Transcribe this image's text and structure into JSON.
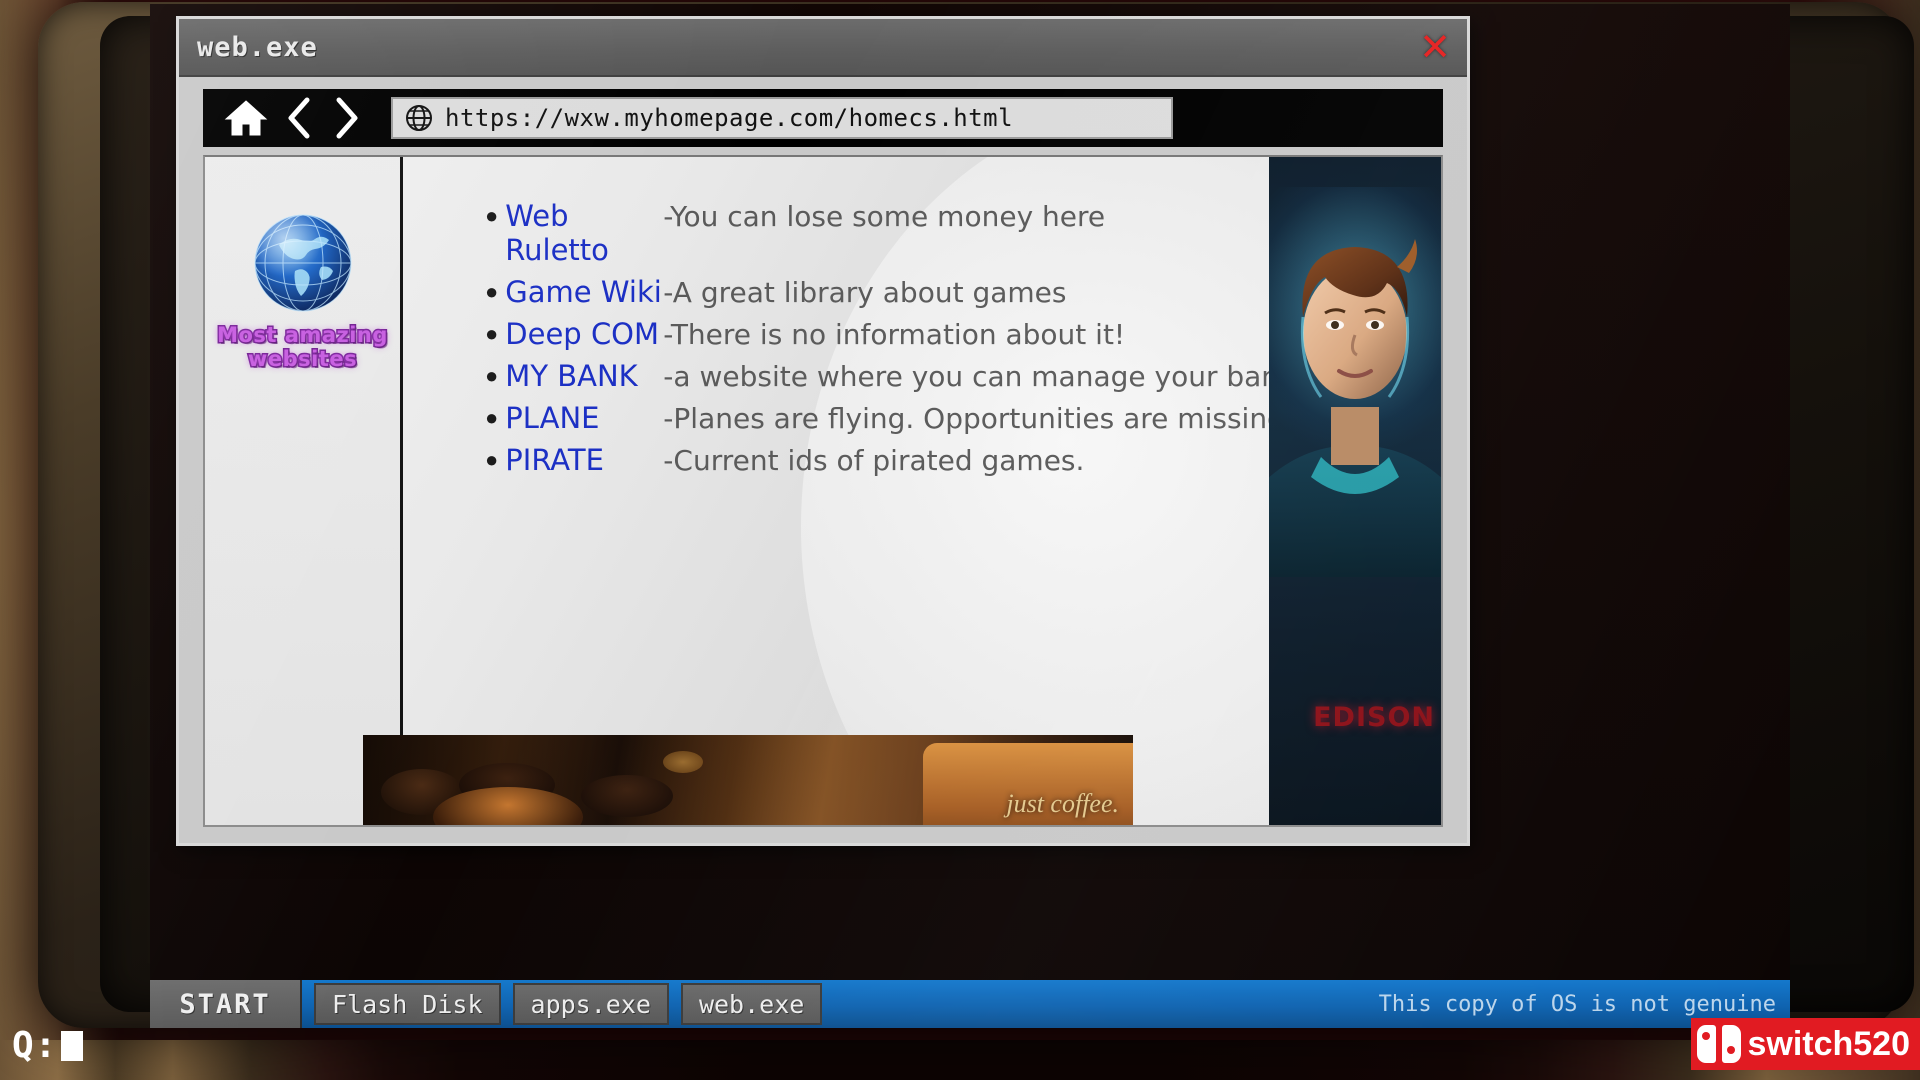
{
  "window": {
    "title": "web.exe",
    "close_label": "✕"
  },
  "browser": {
    "home_icon": "home-icon",
    "back_icon": "back-chevron-icon",
    "forward_icon": "forward-chevron-icon",
    "globe_icon": "globe-icon",
    "url": "https://wxw.myhomepage.com/homecs.html"
  },
  "sidebar": {
    "globe_icon": "world-globe-icon",
    "heading": "Most amazing websites"
  },
  "links": [
    {
      "name": "Web Ruletto",
      "desc": "-You can lose some money here"
    },
    {
      "name": "Game Wiki",
      "desc": "-A great library about games"
    },
    {
      "name": "Deep COM",
      "desc": "-There is no information about it!"
    },
    {
      "name": "MY BANK",
      "desc": "-a website where you can manage your bank accounts"
    },
    {
      "name": "PLANE",
      "desc": "-Planes are flying. Opportunities are missing.."
    },
    {
      "name": "PIRATE",
      "desc": "-Current ids of pirated games."
    }
  ],
  "banner": {
    "text": "just coffee."
  },
  "portrait": {
    "label": "EDISON"
  },
  "taskbar": {
    "start": "START",
    "buttons": [
      "Flash Disk",
      "apps.exe",
      "web.exe"
    ],
    "notice": "This copy of OS is not genuine"
  },
  "overlay": {
    "prompt": "Q:",
    "watermark": "switch520"
  },
  "colors": {
    "link": "#1b2fc4",
    "desc": "#5a5a5a",
    "heading": "#c75de0",
    "taskbar": "#1478cc",
    "close": "#e62020",
    "watermark_bg": "#e11b22"
  }
}
